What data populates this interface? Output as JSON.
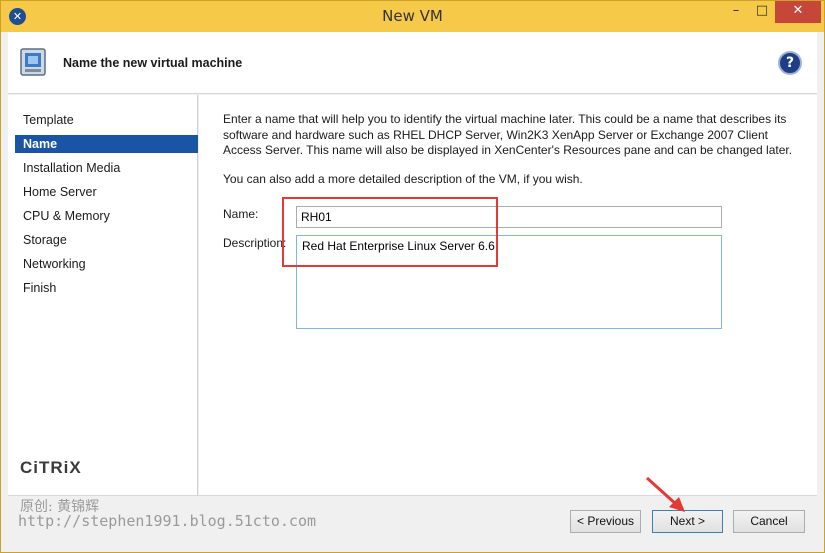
{
  "window": {
    "title": "New VM",
    "app_icon": "✕",
    "minimize": "–",
    "maximize": "□",
    "close": "✕"
  },
  "header": {
    "title": "Name the new virtual machine",
    "help": "?"
  },
  "sidebar": {
    "items": [
      {
        "label": "Template",
        "active": false
      },
      {
        "label": "Name",
        "active": true
      },
      {
        "label": "Installation Media",
        "active": false
      },
      {
        "label": "Home Server",
        "active": false
      },
      {
        "label": "CPU & Memory",
        "active": false
      },
      {
        "label": "Storage",
        "active": false
      },
      {
        "label": "Networking",
        "active": false
      },
      {
        "label": "Finish",
        "active": false
      }
    ],
    "logo": "CiTRiX"
  },
  "main": {
    "description": "Enter a name that will help you to identify the virtual machine later. This could be a name that describes its software and hardware such as RHEL DHCP Server, Win2K3 XenApp Server or Exchange 2007 Client Access Server. This name will also be displayed in XenCenter's Resources pane and can be changed later.",
    "extra": "You can also add a more detailed description of the VM, if you wish.",
    "name_label": "Name:",
    "name_value": "RH01",
    "description_label": "Description:",
    "description_value": "Red Hat Enterprise Linux Server 6.6"
  },
  "footer": {
    "watermark_author": "原创: 黄锦辉",
    "watermark_url": "http://stephen1991.blog.51cto.com",
    "previous": "< Previous",
    "next": "Next >",
    "cancel": "Cancel"
  },
  "colors": {
    "titlebar": "#f7c948",
    "selection": "#1a55a5",
    "highlight": "#e53935"
  }
}
